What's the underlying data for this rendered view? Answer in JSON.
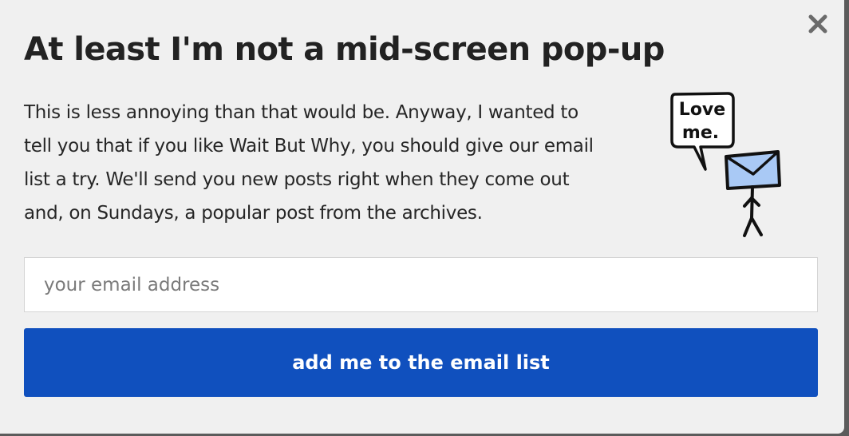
{
  "popup": {
    "title": "At least I'm not a mid-screen pop-up",
    "body_lines": [
      "This is less annoying than that would be. Anyway, I wanted to",
      "tell you that if you like Wait But Why, you should give our email",
      "list a try. We'll send you new posts right when they come out",
      "and, on Sundays, a popular post from the archives."
    ],
    "illustration": {
      "speech_line1": "Love",
      "speech_line2": "me."
    },
    "email_input": {
      "placeholder": "your email address",
      "value": ""
    },
    "submit_label": "add me to the email list"
  },
  "colors": {
    "background": "#f0f0f0",
    "button": "#1050be",
    "title_text": "#222222",
    "envelope": "#a9c9f5"
  },
  "icons": {
    "close": "close-x-icon",
    "illustration": "stick-figure-envelope"
  }
}
